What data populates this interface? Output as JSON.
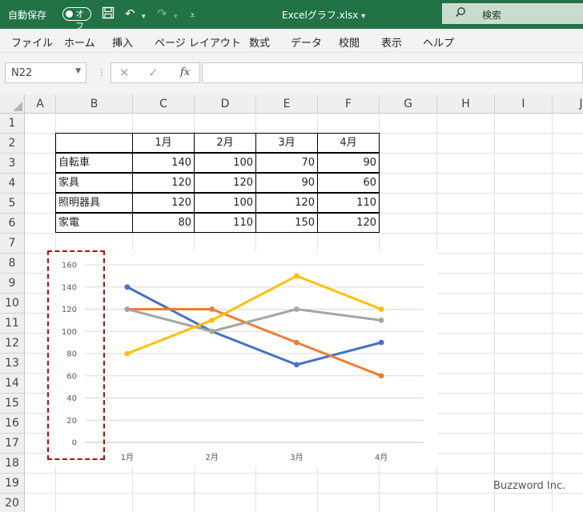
{
  "titlebar": {
    "autosave_label": "自動保存",
    "autosave_state": "オフ",
    "filename": "Excelグラフ.xlsx",
    "filename_dropdown": "▾",
    "search_placeholder": "検索"
  },
  "menu": [
    "ファイル",
    "ホーム",
    "挿入",
    "ページ レイアウト",
    "数式",
    "データ",
    "校閲",
    "表示",
    "ヘルプ"
  ],
  "formula_bar": {
    "namebox": "N22",
    "fx": "fx",
    "formula": ""
  },
  "columns": [
    "A",
    "B",
    "C",
    "D",
    "E",
    "F",
    "G",
    "H",
    "I",
    "J"
  ],
  "rows": [
    "1",
    "2",
    "3",
    "4",
    "5",
    "6",
    "7",
    "8",
    "9",
    "10",
    "11",
    "12",
    "13",
    "14",
    "15",
    "16",
    "17",
    "18",
    "19",
    "20"
  ],
  "table": {
    "headers": [
      "",
      "1月",
      "2月",
      "3月",
      "4月"
    ],
    "rows": [
      [
        "自転車",
        "140",
        "100",
        "70",
        "90"
      ],
      [
        "家具",
        "120",
        "120",
        "90",
        "60"
      ],
      [
        "照明器具",
        "120",
        "100",
        "120",
        "110"
      ],
      [
        "家電",
        "80",
        "110",
        "150",
        "120"
      ]
    ]
  },
  "chart_data": {
    "type": "line",
    "categories": [
      "1月",
      "2月",
      "3月",
      "4月"
    ],
    "series": [
      {
        "name": "自転車",
        "values": [
          140,
          100,
          70,
          90
        ],
        "color": "#4472c4"
      },
      {
        "name": "家具",
        "values": [
          120,
          120,
          90,
          60
        ],
        "color": "#ed7d31"
      },
      {
        "name": "照明器具",
        "values": [
          120,
          100,
          120,
          110
        ],
        "color": "#a5a5a5"
      },
      {
        "name": "家電",
        "values": [
          80,
          110,
          150,
          120
        ],
        "color": "#ffc000"
      }
    ],
    "yticks": [
      "0",
      "20",
      "40",
      "60",
      "80",
      "100",
      "120",
      "140",
      "160"
    ],
    "ylim": [
      0,
      160
    ],
    "grid": true,
    "title": "",
    "xlabel": "",
    "ylabel": ""
  },
  "watermark": "Buzzword Inc."
}
